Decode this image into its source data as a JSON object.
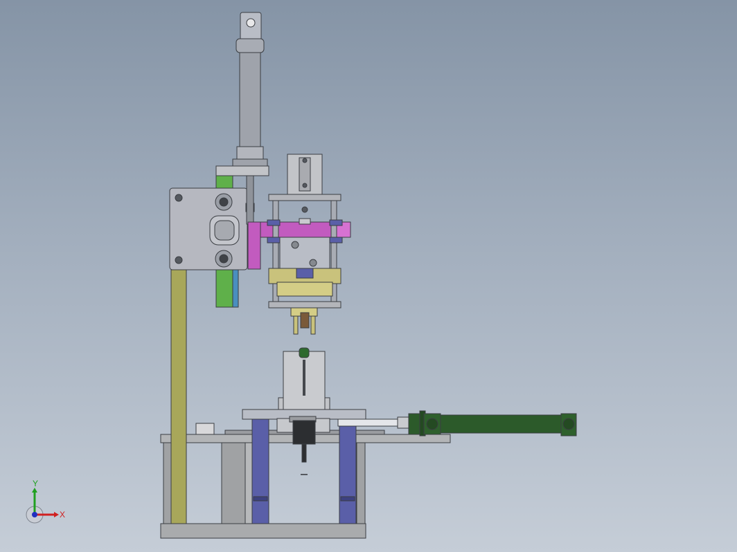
{
  "colors": {
    "viewport_top": "#8594a6",
    "viewport_bottom": "#c5cdd7",
    "steel": "#b9bdc6",
    "steel_dark": "#55595f",
    "frame_gray": "#a9abad",
    "olive_column": "#a8a75a",
    "green_guide": "#5fb04a",
    "magenta_arm": "#c25bbf",
    "blue_block": "#5a5fa8",
    "yellow_gripper": "#c9c27c",
    "cylinder_green": "#2c5a2a",
    "axis_x": "#d02020",
    "axis_y": "#20a020",
    "axis_z": "#2030c0"
  },
  "triad": {
    "x_label": "X",
    "y_label": "Y"
  }
}
